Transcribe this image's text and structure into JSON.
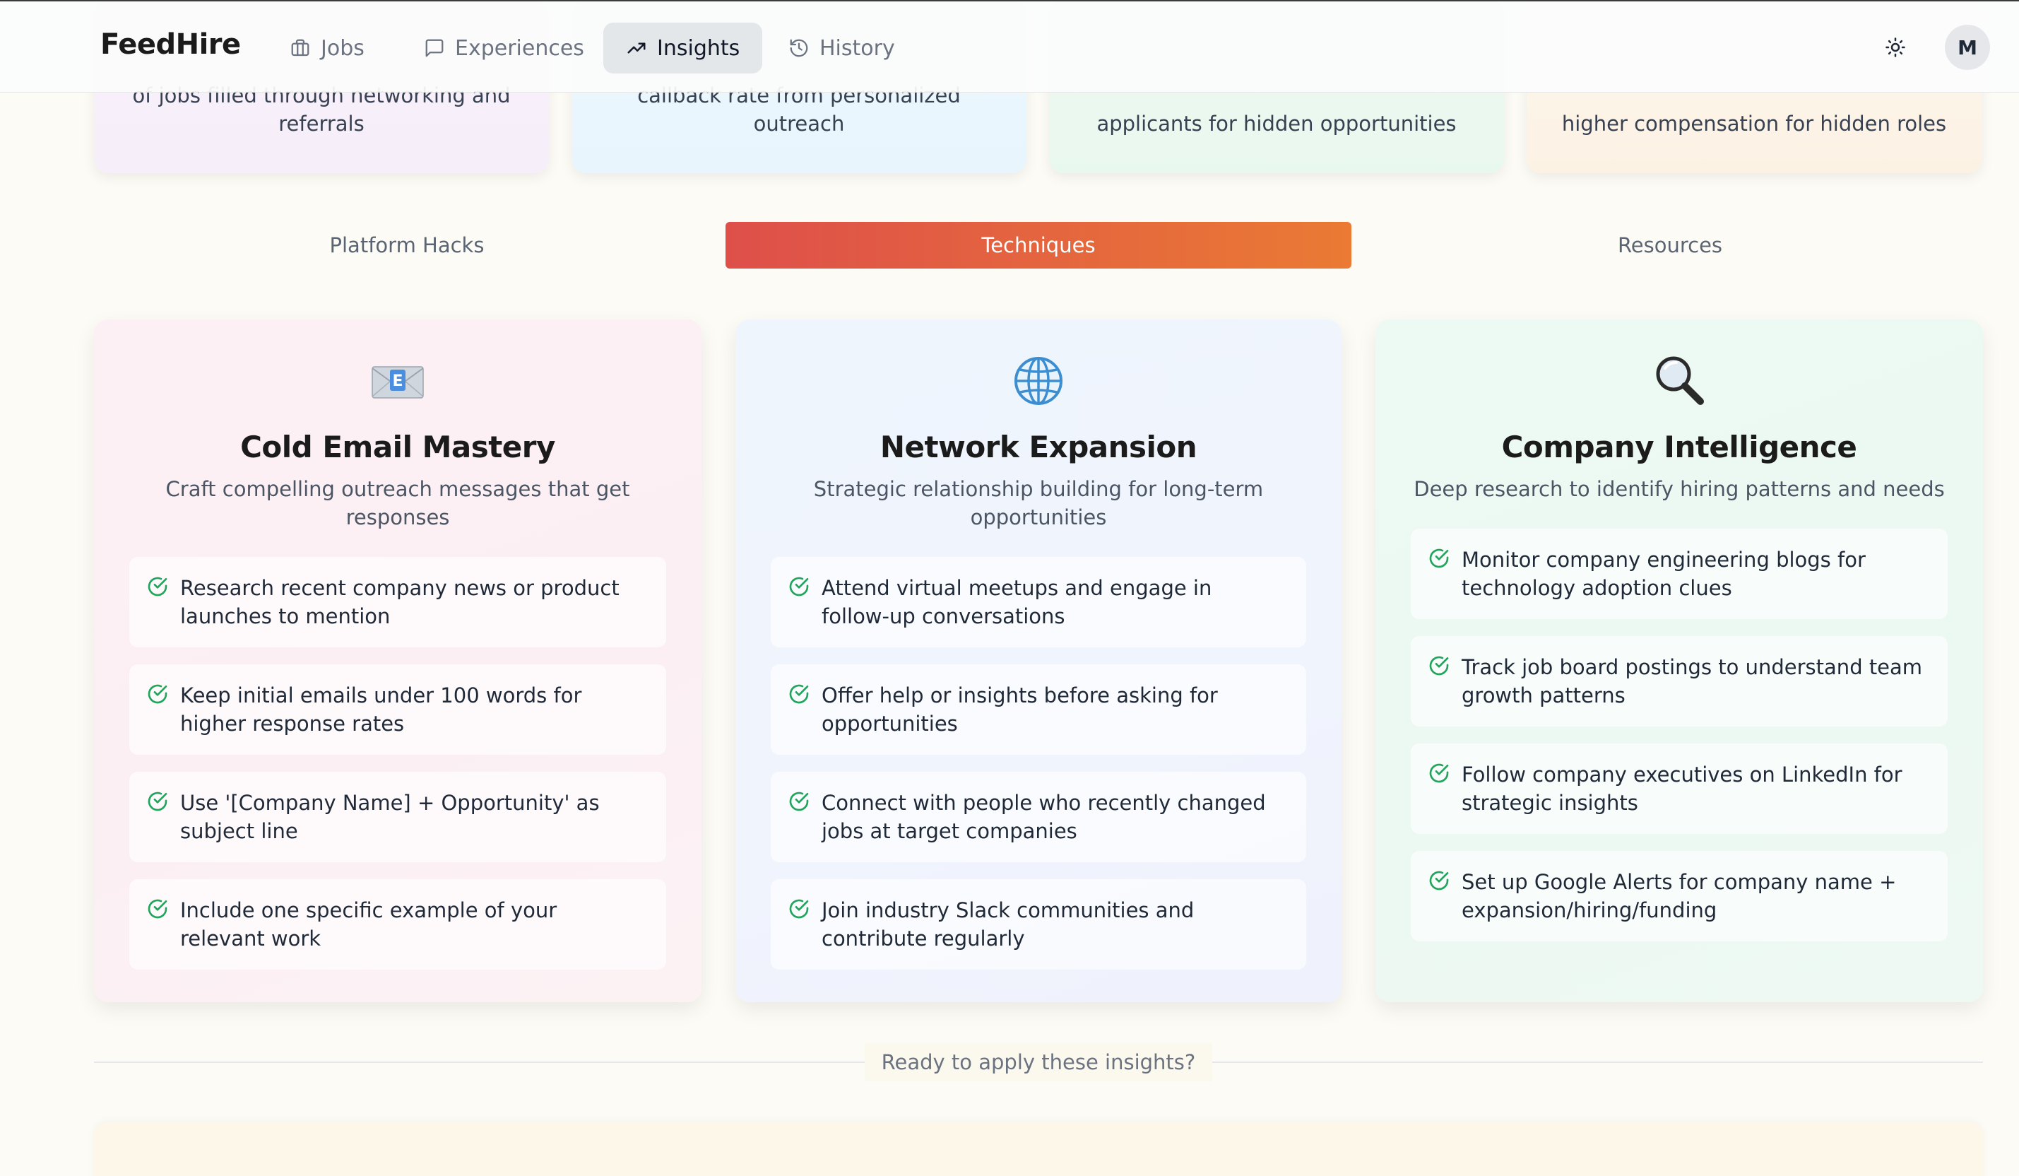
{
  "nav": {
    "logo": "FeedHire",
    "items": [
      {
        "label": "Jobs",
        "icon": "briefcase-icon"
      },
      {
        "label": "Experiences",
        "icon": "chat-bubble-icon"
      },
      {
        "label": "Insights",
        "icon": "trending-up-icon",
        "active": true
      },
      {
        "label": "History",
        "icon": "history-icon"
      }
    ],
    "theme_icon": "sun-icon",
    "avatar_initial": "M"
  },
  "stats": [
    {
      "text": "of jobs filled through networking and referrals"
    },
    {
      "text": "callback rate from personalized outreach"
    },
    {
      "text": "applicants for hidden opportunities"
    },
    {
      "text": "higher compensation for hidden roles"
    }
  ],
  "tabs": [
    {
      "label": "Platform Hacks"
    },
    {
      "label": "Techniques",
      "active": true
    },
    {
      "label": "Resources"
    }
  ],
  "cards": [
    {
      "icon": "envelope-icon",
      "title": "Cold Email Mastery",
      "description": "Craft compelling outreach messages that get responses",
      "tips": [
        "Research recent company news or product launches to mention",
        "Keep initial emails under 100 words for higher response rates",
        "Use '[Company Name] + Opportunity' as subject line",
        "Include one specific example of your relevant work"
      ]
    },
    {
      "icon": "globe-icon",
      "title": "Network Expansion",
      "description": "Strategic relationship building for long-term opportunities",
      "tips": [
        "Attend virtual meetups and engage in follow-up conversations",
        "Offer help or insights before asking for opportunities",
        "Connect with people who recently changed jobs at target companies",
        "Join industry Slack communities and contribute regularly"
      ]
    },
    {
      "icon": "magnifying-glass-icon",
      "title": "Company Intelligence",
      "description": "Deep research to identify hiring patterns and needs",
      "tips": [
        "Monitor company engineering blogs for technology adoption clues",
        "Track job board postings to understand team growth patterns",
        "Follow company executives on LinkedIn for strategic insights",
        "Set up Google Alerts for company name + expansion/hiring/funding"
      ]
    }
  ],
  "footer": {
    "divider_label": "Ready to apply these insights?"
  },
  "colors": {
    "accent_start": "#de4f4a",
    "accent_end": "#ea7a34",
    "check": "#22a45d"
  }
}
